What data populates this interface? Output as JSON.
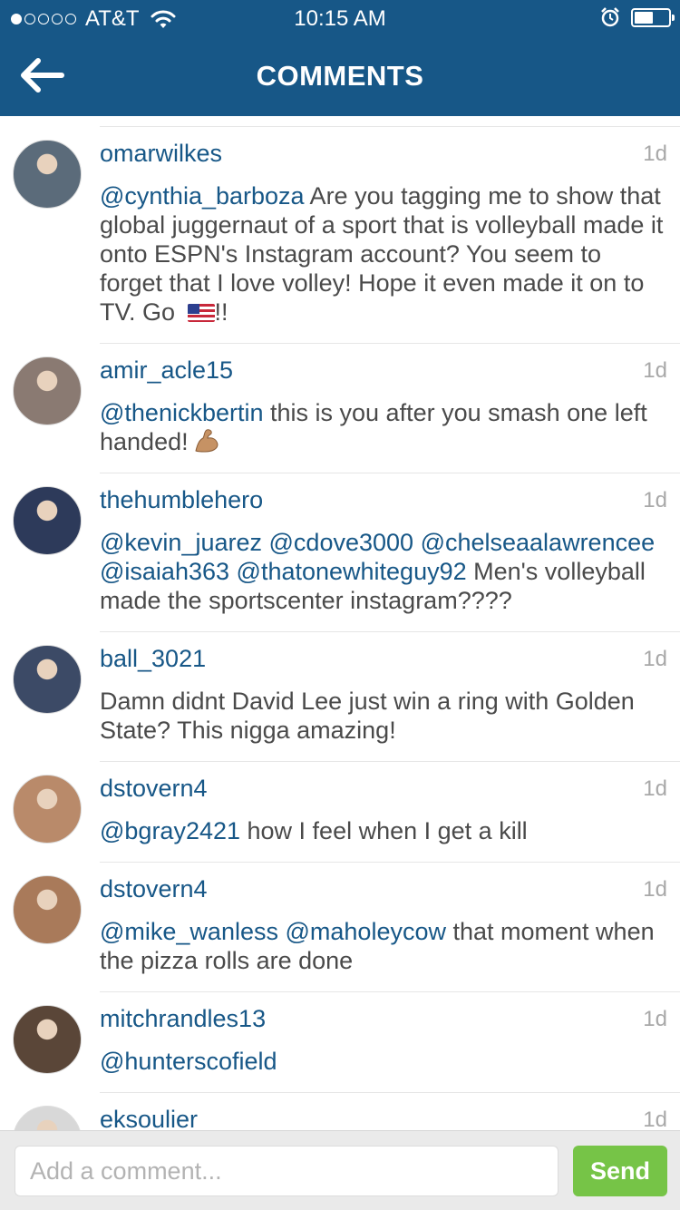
{
  "status_bar": {
    "signal_bars_filled": 1,
    "signal_bars_total": 5,
    "carrier": "AT&T",
    "time": "10:15 AM",
    "battery_level": 0.55
  },
  "header": {
    "title": "COMMENTS",
    "back_icon": "back-arrow-icon"
  },
  "comments": [
    {
      "username": "omarwilkes",
      "ago": "1d",
      "avatar_color": "#5b6b7a",
      "segments": [
        {
          "t": "@cynthia_barboza",
          "m": true
        },
        {
          "t": " Are you tagging me to show that global juggernaut of a sport that is volleyball made it onto ESPN's Instagram account? You seem to forget that I love volley! Hope it even made it on to TV. Go ",
          "m": false
        }
      ],
      "after_flag": "!!"
    },
    {
      "username": "amir_acle15",
      "ago": "1d",
      "avatar_color": "#8a7a72",
      "segments": [
        {
          "t": "@thenickbertin",
          "m": true
        },
        {
          "t": " this is you after you smash one left handed!",
          "m": false
        }
      ]
    },
    {
      "username": "thehumblehero",
      "ago": "1d",
      "avatar_color": "#2d3a5a",
      "segments": [
        {
          "t": "@kevin_juarez",
          "m": true
        },
        {
          "t": " ",
          "m": false
        },
        {
          "t": "@cdove3000",
          "m": true
        },
        {
          "t": " ",
          "m": false
        },
        {
          "t": "@chelseaalawrencee",
          "m": true
        },
        {
          "t": " ",
          "m": false
        },
        {
          "t": "@isaiah363",
          "m": true
        },
        {
          "t": " ",
          "m": false
        },
        {
          "t": "@thatonewhiteguy92",
          "m": true
        },
        {
          "t": " Men's volleyball made the sportscenter instagram????",
          "m": false
        }
      ]
    },
    {
      "username": "ball_3021",
      "ago": "1d",
      "avatar_color": "#3c4a66",
      "segments": [
        {
          "t": "Damn didnt David Lee just win a ring with Golden State? This nigga amazing!",
          "m": false
        }
      ]
    },
    {
      "username": "dstovern4",
      "ago": "1d",
      "avatar_color": "#b98a6a",
      "segments": [
        {
          "t": "@bgray2421",
          "m": true
        },
        {
          "t": " how I feel when I get a kill",
          "m": false
        }
      ]
    },
    {
      "username": "dstovern4",
      "ago": "1d",
      "avatar_color": "#a97a5a",
      "segments": [
        {
          "t": "@mike_wanless",
          "m": true
        },
        {
          "t": " ",
          "m": false
        },
        {
          "t": "@maholeycow",
          "m": true
        },
        {
          "t": " that moment when the pizza rolls are done",
          "m": false
        }
      ]
    },
    {
      "username": "mitchrandles13",
      "ago": "1d",
      "avatar_color": "#5a4638",
      "segments": [
        {
          "t": "@hunterscofield",
          "m": true
        }
      ]
    },
    {
      "username": "eksoulier",
      "ago": "1d",
      "avatar_color": "#d8d8d8",
      "segments": []
    }
  ],
  "composer": {
    "placeholder": "Add a comment...",
    "send_label": "Send",
    "send_color": "#76c447"
  },
  "colors": {
    "header_bg": "#175787",
    "username": "#175787",
    "mention": "#175787",
    "body_text": "#4a4a4a",
    "timestamp": "#a8a8a8"
  }
}
